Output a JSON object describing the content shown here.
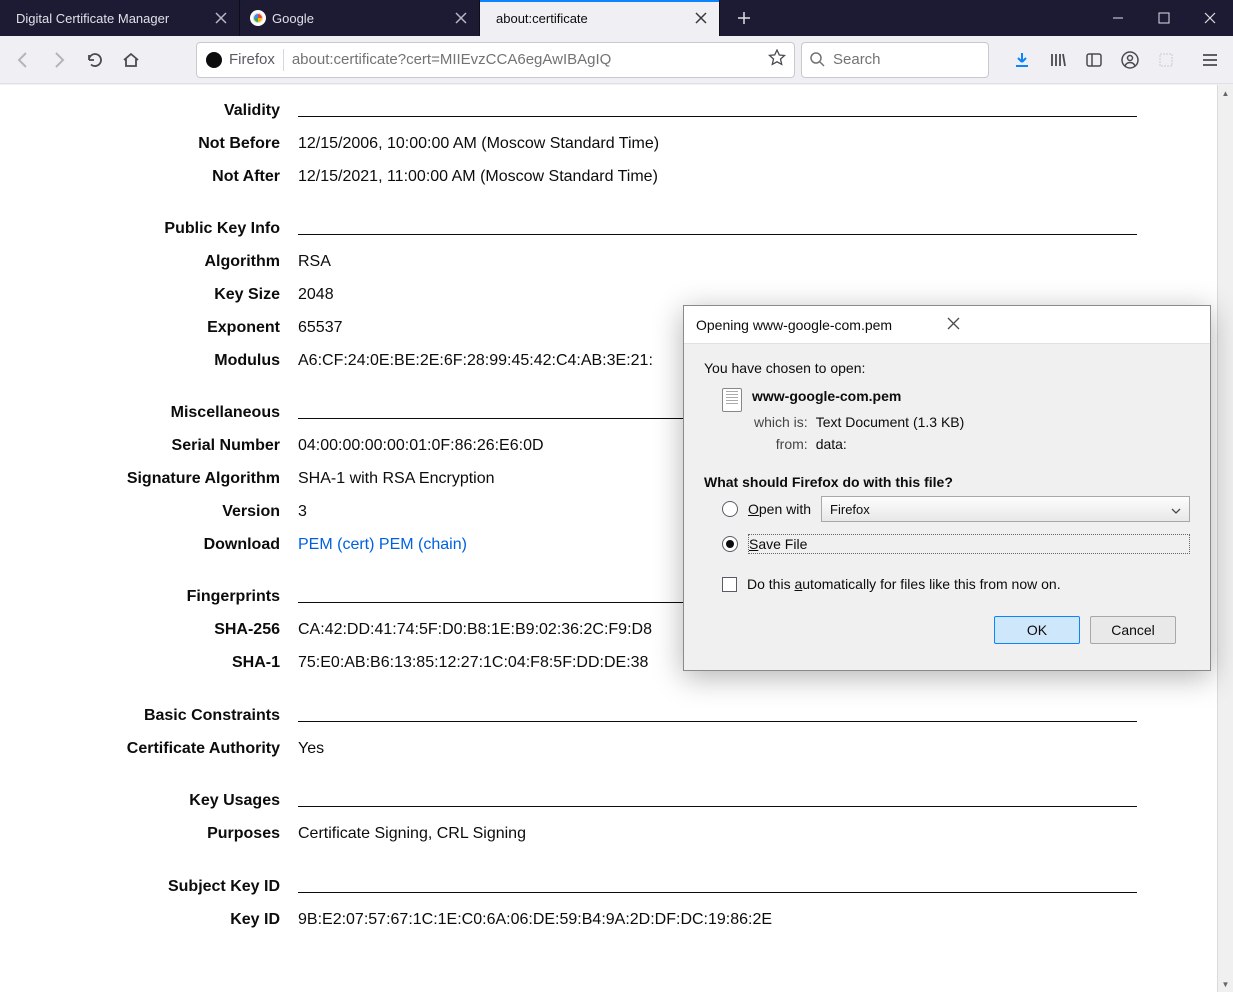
{
  "tabs": [
    {
      "label": "Digital Certificate Manager"
    },
    {
      "label": "Google"
    },
    {
      "label": "about:certificate"
    }
  ],
  "urlbar": {
    "identity": "Firefox",
    "url": "about:certificate?cert=MIIEvzCCA6egAwIBAgIQ"
  },
  "search": {
    "placeholder": "Search"
  },
  "cert": {
    "sections": {
      "validity": "Validity",
      "pub": "Public Key Info",
      "misc": "Miscellaneous",
      "fp": "Fingerprints",
      "bc": "Basic Constraints",
      "ku": "Key Usages",
      "ski": "Subject Key ID"
    },
    "labels": {
      "nb": "Not Before",
      "na": "Not After",
      "alg": "Algorithm",
      "ks": "Key Size",
      "exp": "Exponent",
      "mod": "Modulus",
      "sn": "Serial Number",
      "sigalg": "Signature Algorithm",
      "ver": "Version",
      "dl": "Download",
      "sha256": "SHA-256",
      "sha1": "SHA-1",
      "ca": "Certificate Authority",
      "purp": "Purposes",
      "keyid": "Key ID"
    },
    "values": {
      "nb": "12/15/2006, 10:00:00 AM (Moscow Standard Time)",
      "na": "12/15/2021, 11:00:00 AM (Moscow Standard Time)",
      "alg": "RSA",
      "ks": "2048",
      "exp": "65537",
      "mod": "A6:CF:24:0E:BE:2E:6F:28:99:45:42:C4:AB:3E:21:",
      "sn": "04:00:00:00:00:01:0F:86:26:E6:0D",
      "sigalg": "SHA-1 with RSA Encryption",
      "ver": "3",
      "dl_cert": "PEM (cert)",
      "dl_chain": "PEM (chain)",
      "sha256": "CA:42:DD:41:74:5F:D0:B8:1E:B9:02:36:2C:F9:D8",
      "sha1": "75:E0:AB:B6:13:85:12:27:1C:04:F8:5F:DD:DE:38",
      "ca": "Yes",
      "purp": "Certificate Signing, CRL Signing",
      "keyid": "9B:E2:07:57:67:1C:1E:C0:6A:06:DE:59:B4:9A:2D:DF:DC:19:86:2E"
    }
  },
  "dialog": {
    "title": "Opening www-google-com.pem",
    "chosen": "You have chosen to open:",
    "file": "www-google-com.pem",
    "which_lbl": "which is:",
    "which_val": "Text Document (1.3 KB)",
    "from_lbl": "from:",
    "from_val": "data:",
    "question": "What should Firefox do with this file?",
    "open_pre": "O",
    "open_post": "pen with",
    "open_app": "Firefox",
    "save_pre": "S",
    "save_post": "ave File",
    "auto_pre": "Do this ",
    "auto_u": "a",
    "auto_post": "utomatically for files like this from now on.",
    "ok": "OK",
    "cancel": "Cancel"
  }
}
